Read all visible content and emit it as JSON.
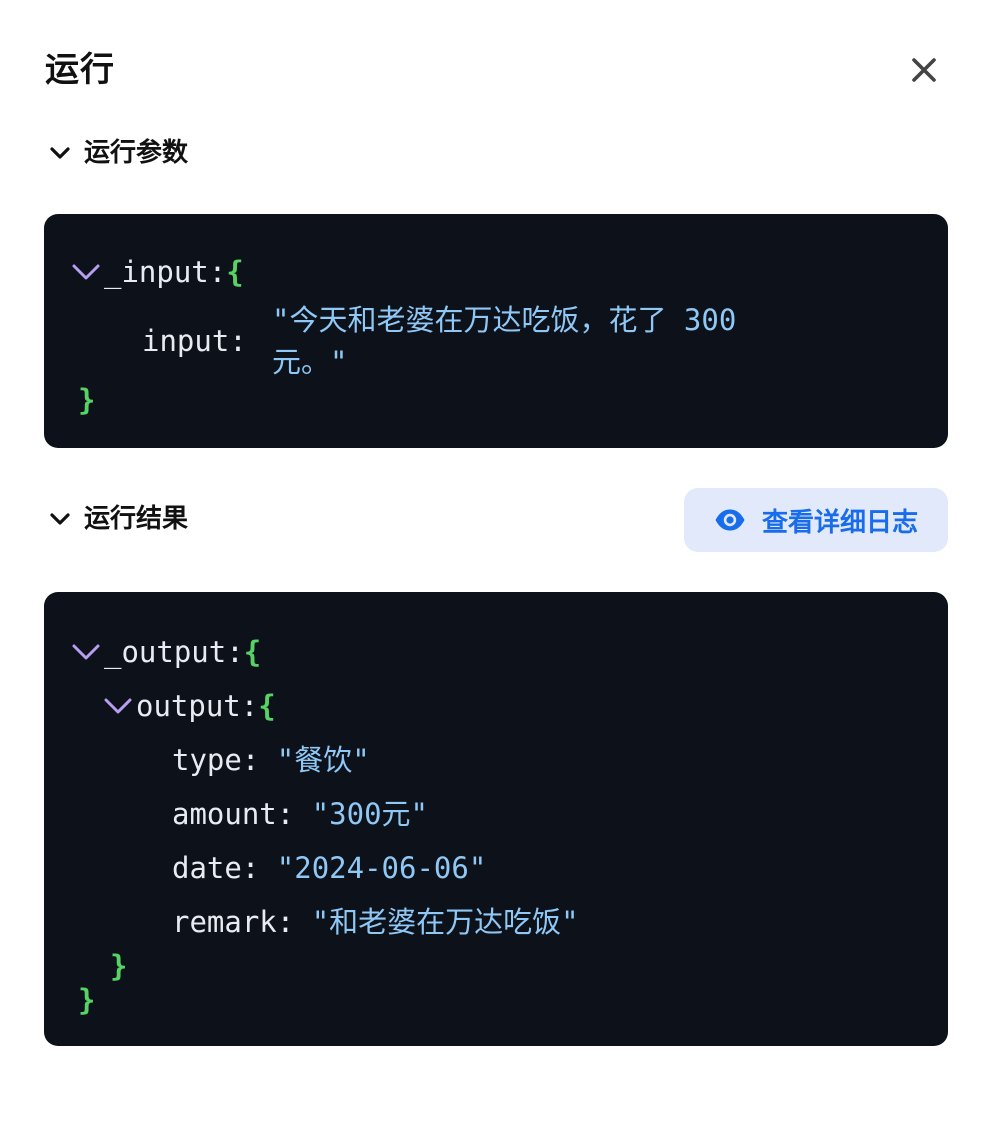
{
  "panel": {
    "title": "运行"
  },
  "params_section": {
    "label": "运行参数",
    "code": {
      "root_key": "_input:",
      "open_brace": "{",
      "close_brace": "}",
      "field_key": "input:",
      "field_value_line1": "\"今天和老婆在万达吃饭，花了 300",
      "field_value_line2": "元。\""
    }
  },
  "results_section": {
    "label": "运行结果",
    "log_button_label": "查看详细日志",
    "code": {
      "root_key": "_output:",
      "root_open": "{",
      "child_key": "output:",
      "child_open": "{",
      "fields": [
        {
          "key": "type:",
          "value": "\"餐饮\""
        },
        {
          "key": "amount:",
          "value": "\"300元\""
        },
        {
          "key": "date:",
          "value": "\"2024-06-06\""
        },
        {
          "key": "remark:",
          "value": "\"和老婆在万达吃饭\""
        }
      ],
      "child_close": "}",
      "root_close": "}"
    }
  },
  "colors": {
    "code_bg": "#0c111a",
    "brace": "#56d364",
    "string": "#8fc7f5",
    "caret": "#b79ef0",
    "button_bg": "#e1e9fb",
    "button_text": "#1a6dea"
  },
  "icons": {
    "close": "close-icon",
    "chevron": "chevron-down-icon",
    "eye": "eye-icon"
  }
}
